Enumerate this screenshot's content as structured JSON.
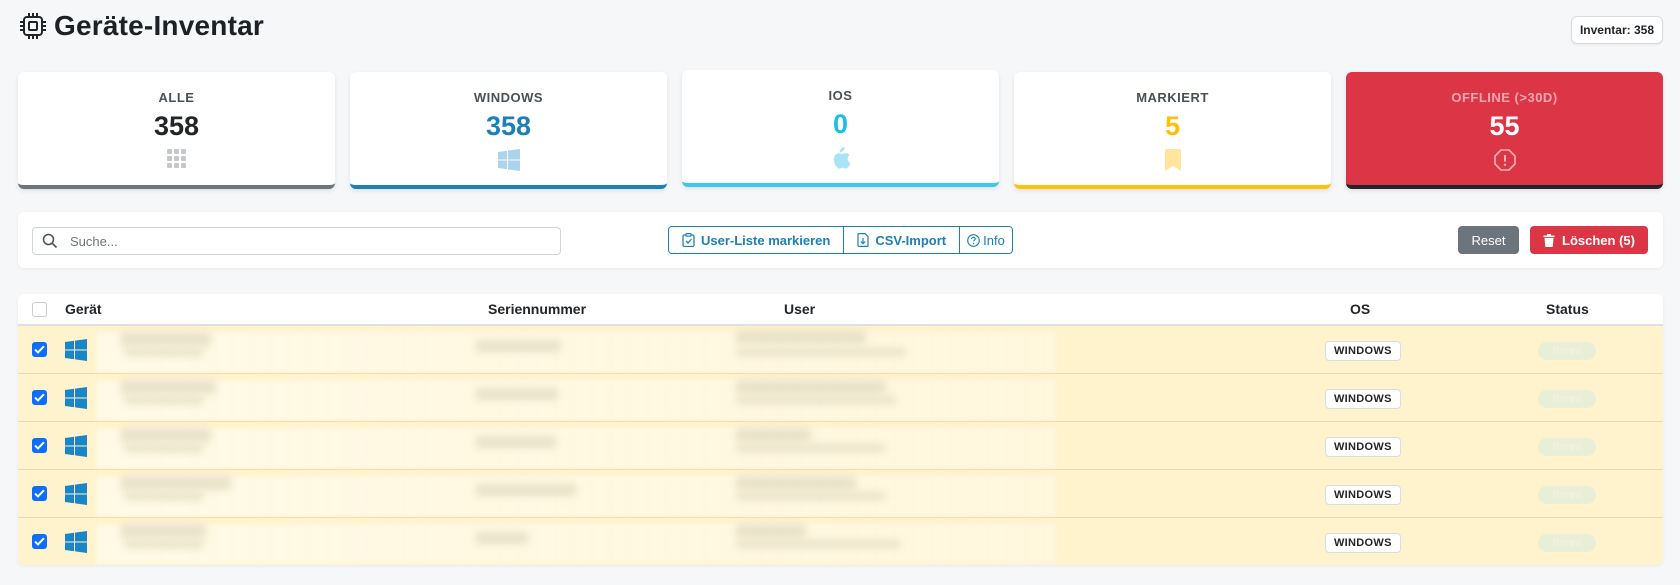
{
  "header": {
    "title": "Geräte-Inventar",
    "icon": "cpu-chip-icon",
    "inventory_badge": "Inventar: 358"
  },
  "cards": [
    {
      "label": "ALLE",
      "value": "358",
      "icon": "grid-icon",
      "color": "#6c757d"
    },
    {
      "label": "WINDOWS",
      "value": "358",
      "icon": "windows-icon",
      "color": "#1b7fb8"
    },
    {
      "label": "IOS",
      "value": "0",
      "icon": "apple-icon",
      "color": "#17c1e6"
    },
    {
      "label": "MARKIERT",
      "value": "5",
      "icon": "bookmark-icon",
      "color": "#ffc107"
    },
    {
      "label": "OFFLINE (>30D)",
      "value": "55",
      "icon": "alert-circle-icon",
      "color": "#dc3545"
    }
  ],
  "toolbar": {
    "search_placeholder": "Suche...",
    "mark_user_list": "User-Liste markieren",
    "csv_import": "CSV-Import",
    "info": "Info",
    "reset": "Reset",
    "delete": "Löschen (5)"
  },
  "table": {
    "columns": [
      "Gerät",
      "Seriennummer",
      "User",
      "OS",
      "Status"
    ],
    "rows": [
      {
        "checked": true,
        "os": "WINDOWS",
        "status": "Bereit"
      },
      {
        "checked": true,
        "os": "WINDOWS",
        "status": "Bereit"
      },
      {
        "checked": true,
        "os": "WINDOWS",
        "status": "Bereit"
      },
      {
        "checked": true,
        "os": "WINDOWS",
        "status": "Bereit"
      },
      {
        "checked": true,
        "os": "WINDOWS",
        "status": "Bereit"
      }
    ]
  },
  "colors": {
    "primary": "#1b7fb8",
    "danger": "#dc3545",
    "warning": "#ffc107",
    "selected_row": "#fff3cd"
  }
}
